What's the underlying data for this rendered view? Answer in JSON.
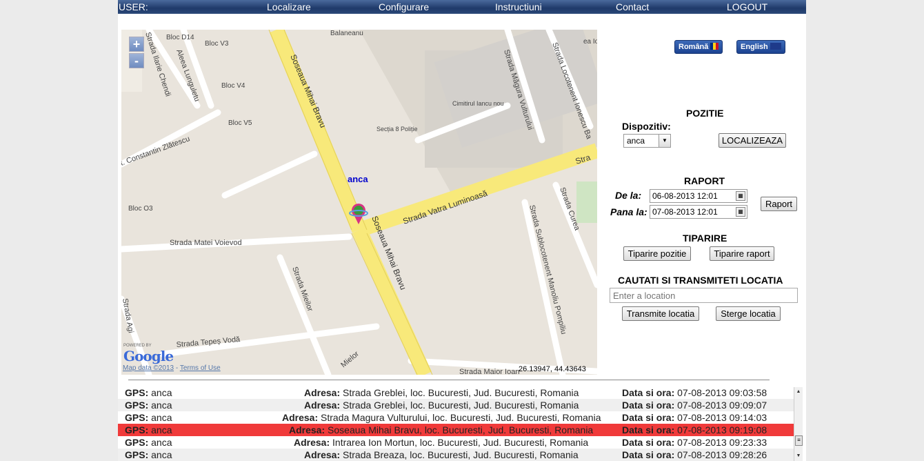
{
  "nav": {
    "user": "USER:",
    "localizare": "Localizare",
    "configurare": "Configurare",
    "instructiuni": "Instructiuni",
    "contact": "Contact",
    "logout": "LOGOUT"
  },
  "map": {
    "zoom_in": "+",
    "zoom_out": "-",
    "marker_label": "anca",
    "coords": "26.13947, 44.43643",
    "map_data": "Map data ©2013",
    "terms": "Terms of Use",
    "powered_by": "POWERED BY",
    "google": "Google",
    "labels": {
      "balaneanu": "Balaneanu",
      "bloc_d14": "Bloc D14",
      "bloc_v3": "Bloc V3",
      "bloc_v4": "Bloc V4",
      "bloc_v5": "Bloc V5",
      "bloc_o3": "Bloc O3",
      "ilarie": "Strada Ilarie Chendi",
      "lunguletu": "Aleea Lunguletu",
      "zlatescu": "t. Constantin Zlătescu",
      "mihai1": "Soseaua Mihai Bravu",
      "mihai2": "Soseaua Mihai Bravu",
      "cimitirul": "Cimitirul Iancu nou",
      "sectia": "Secția 8 Poliție",
      "magura": "Strada Măgura Vulturului",
      "locotenent": "Strada Locotenent Ionescu Ba",
      "vatra": "Strada Vatra Luminoasă",
      "stra": "Stra",
      "matei": "Strada Matei Voievod",
      "mieilor": "Strada Mieilor",
      "curea": "Strada Curea",
      "sublocotenent": "Strada Sublocotenent Manoliu Pompiliu",
      "agi": "Strada Agi",
      "tepes": "Strada Tepeș Vodă",
      "mielor2": "Mielor",
      "maior": "Strada Maior Ioan",
      "ion": "ea Ion B"
    }
  },
  "lang": {
    "romana": "Română",
    "english": "English"
  },
  "panel": {
    "pozitie_title": "POZITIE",
    "dispozitiv_label": "Dispozitiv:",
    "device_value": "anca",
    "localizeaza": "LOCALIZEAZA",
    "raport_title": "RAPORT",
    "de_la_label": "De la:",
    "de_la_value": "06-08-2013 12:01",
    "pana_la_label": "Pana la:",
    "pana_la_value": "07-08-2013 12:01",
    "raport_btn": "Raport",
    "tiparire_title": "TIPARIRE",
    "tiparire_pozitie": "Tiparire pozitie",
    "tiparire_raport": "Tiparire raport",
    "cautati_title": "CAUTATI SI TRANSMITETI LOCATIA",
    "location_placeholder": "Enter a location",
    "transmite": "Transmite locatia",
    "sterge": "Sterge locatia"
  },
  "log": {
    "gps_label": "GPS:",
    "adresa_label": "Adresa:",
    "data_label": "Data si ora:",
    "rows": [
      {
        "device": "anca",
        "address": "Strada Greblei, loc. Bucuresti, Jud. Bucuresti, Romania",
        "datetime": "07-08-2013 09:03:58"
      },
      {
        "device": "anca",
        "address": "Strada Greblei, loc. Bucuresti, Jud. Bucuresti, Romania",
        "datetime": "07-08-2013 09:09:07"
      },
      {
        "device": "anca",
        "address": "Strada Magura Vulturului, loc. Bucuresti, Jud. Bucuresti, Romania",
        "datetime": "07-08-2013 09:14:03"
      },
      {
        "device": "anca",
        "address": "Soseaua Mihai Bravu, loc. Bucuresti, Jud. Bucuresti, Romania",
        "datetime": "07-08-2013 09:19:08"
      },
      {
        "device": "anca",
        "address": "Intrarea Ion Mortun, loc. Bucuresti, Jud. Bucuresti, Romania",
        "datetime": "07-08-2013 09:23:33"
      },
      {
        "device": "anca",
        "address": "Strada Breaza, loc. Bucuresti, Jud. Bucuresti, Romania",
        "datetime": "07-08-2013 09:28:26"
      }
    ],
    "selected_index": 3
  },
  "colors": {
    "nav_bg": "#2a4878",
    "road_main": "#f8e97a",
    "selected_row": "#f03a3a",
    "marker": "#d63384"
  }
}
